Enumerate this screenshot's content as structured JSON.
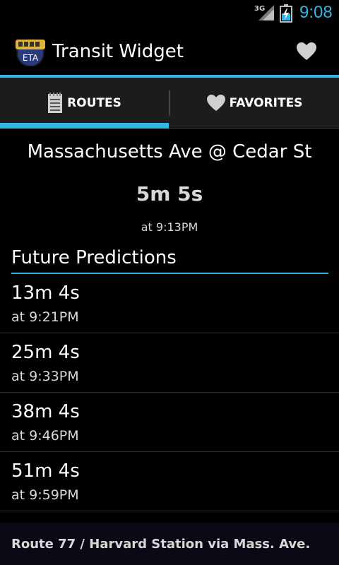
{
  "status_bar": {
    "network": "3G",
    "time": "9:08"
  },
  "action_bar": {
    "app_icon_text": "ETA",
    "title": "Transit Widget",
    "favorite_icon": "heart-icon"
  },
  "tabs": [
    {
      "label": "ROUTES",
      "icon": "list-icon",
      "selected": true
    },
    {
      "label": "FAVORITES",
      "icon": "heart-icon",
      "selected": false
    }
  ],
  "stop": {
    "name": "Massachusetts Ave @ Cedar St",
    "next_eta": "5m 5s",
    "next_at": "at 9:13PM"
  },
  "future": {
    "header": "Future Predictions",
    "items": [
      {
        "eta": "13m 4s",
        "at": "at 9:21PM"
      },
      {
        "eta": "25m 4s",
        "at": "at 9:33PM"
      },
      {
        "eta": "38m 4s",
        "at": "at 9:46PM"
      },
      {
        "eta": "51m 4s",
        "at": "at 9:59PM"
      }
    ]
  },
  "footer": {
    "route": "Route 77 / Harvard Station via Mass. Ave."
  },
  "colors": {
    "accent": "#33b5e5",
    "background": "#000000",
    "tab_bg": "#1c1c1c"
  }
}
